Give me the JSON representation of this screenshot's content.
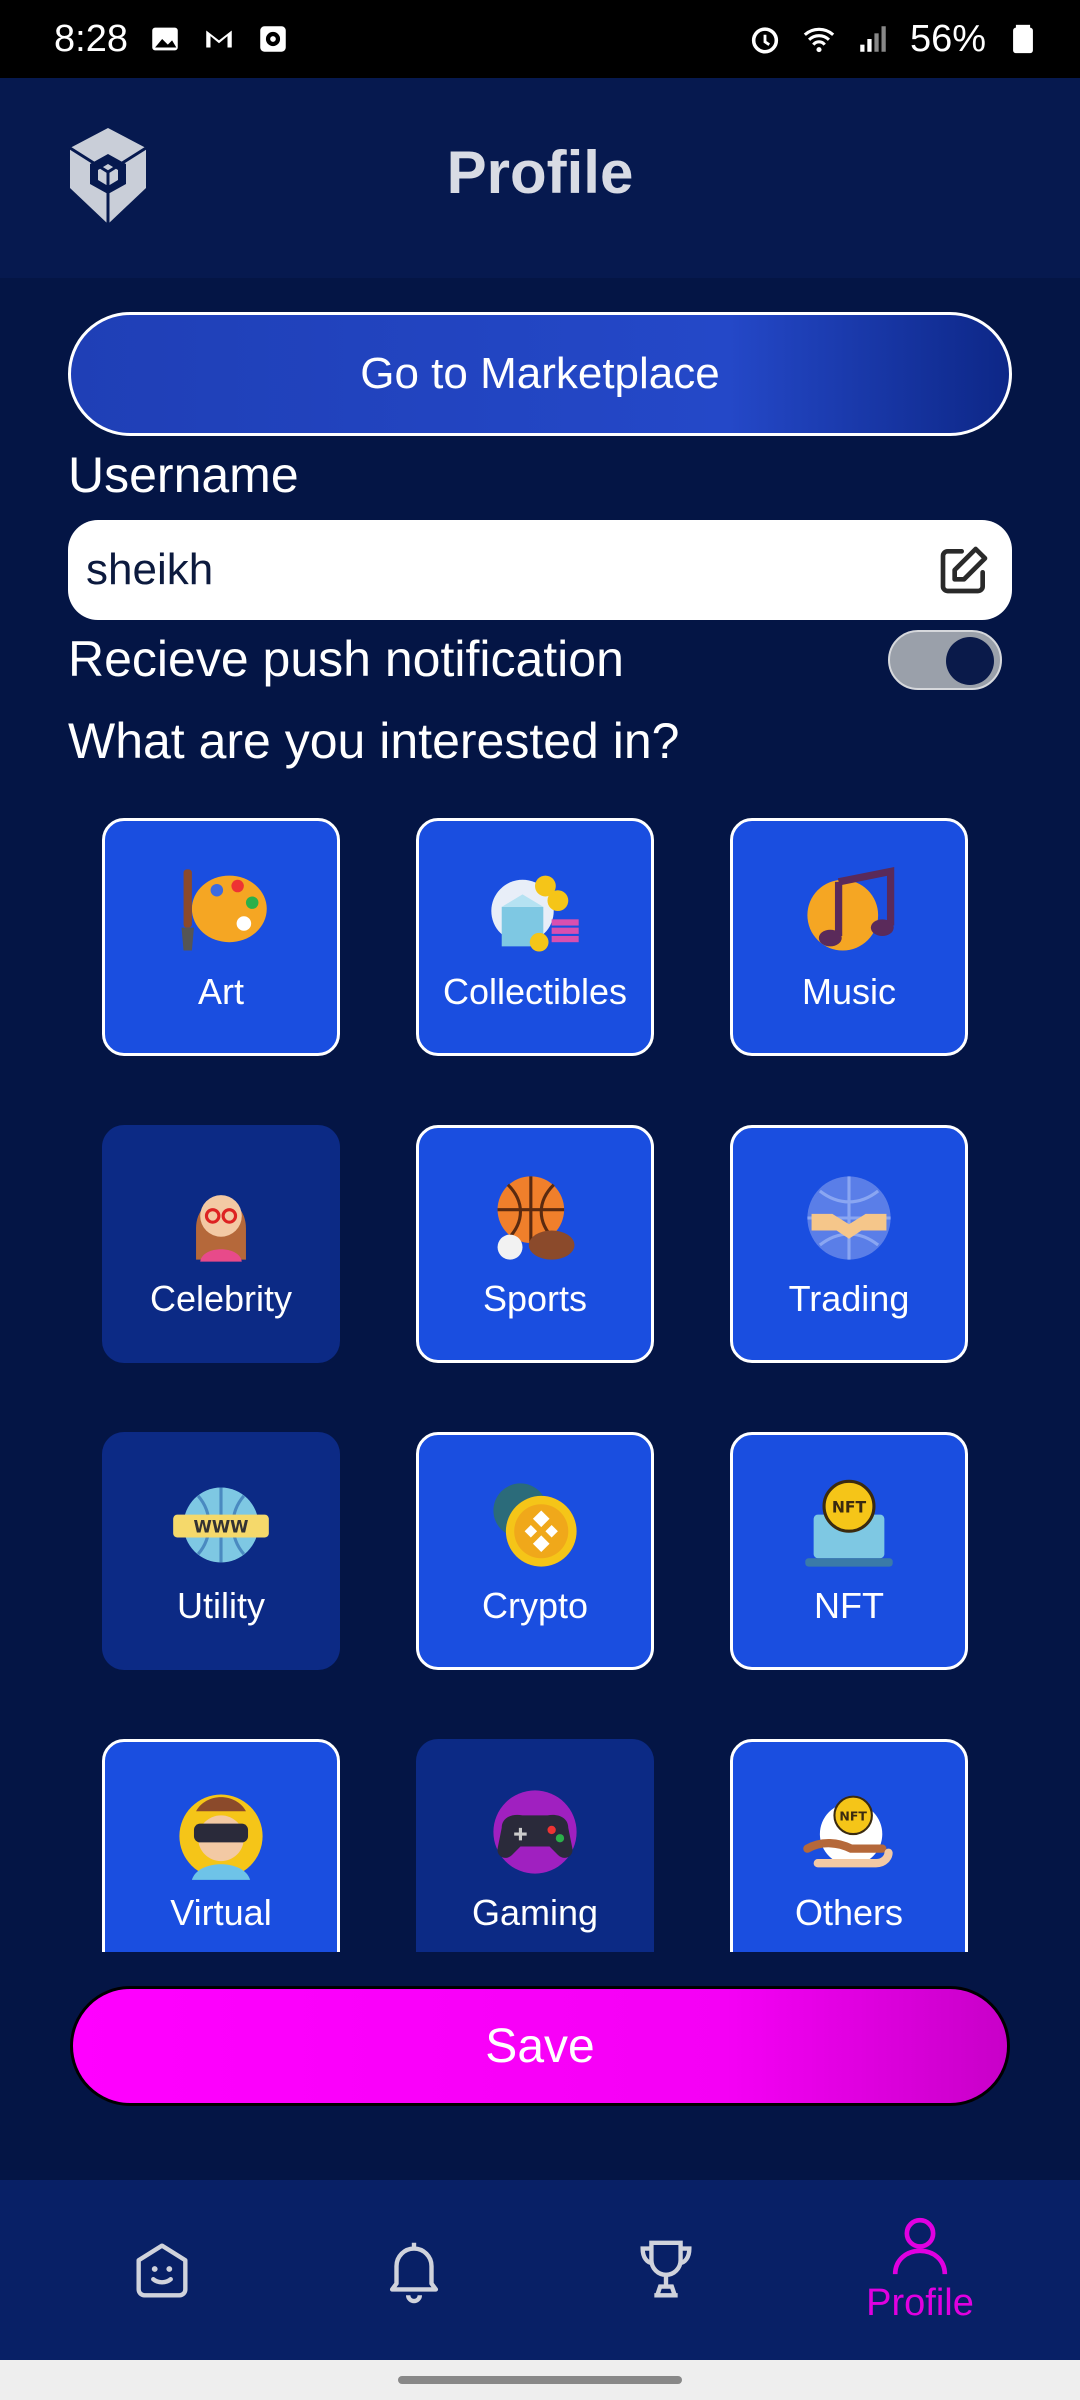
{
  "status_bar": {
    "time": "8:28",
    "battery": "56%",
    "left_icons": [
      "image-icon",
      "gmail-icon",
      "camera-app-icon"
    ],
    "right_icons": [
      "alarm-icon",
      "wifi-icon",
      "signal-icon",
      "battery-icon"
    ]
  },
  "header": {
    "title": "Profile",
    "logo_icon": "shield-logo-icon"
  },
  "profile": {
    "marketplace_button": "Go to Marketplace",
    "username_label": "Username",
    "username_value": "sheikh",
    "push_label": "Recieve push notification",
    "push_enabled": true,
    "interest_label": "What are you interested in?"
  },
  "interests": [
    {
      "label": "Art",
      "icon": "palette-icon",
      "selected": true
    },
    {
      "label": "Collectibles",
      "icon": "coins-box-icon",
      "selected": true
    },
    {
      "label": "Music",
      "icon": "music-note-icon",
      "selected": true
    },
    {
      "label": "Celebrity",
      "icon": "celebrity-icon",
      "selected": false
    },
    {
      "label": "Sports",
      "icon": "sports-balls-icon",
      "selected": true
    },
    {
      "label": "Trading",
      "icon": "handshake-globe-icon",
      "selected": true
    },
    {
      "label": "Utility",
      "icon": "www-globe-icon",
      "selected": false
    },
    {
      "label": "Crypto",
      "icon": "crypto-coin-icon",
      "selected": true
    },
    {
      "label": "NFT",
      "icon": "nft-laptop-icon",
      "selected": true
    },
    {
      "label": "Virtual",
      "icon": "vr-headset-icon",
      "selected": true
    },
    {
      "label": "Gaming",
      "icon": "gamepad-icon",
      "selected": false
    },
    {
      "label": "Others",
      "icon": "nft-hand-icon",
      "selected": true
    }
  ],
  "save_button": "Save",
  "bottom_nav": [
    {
      "name": "home",
      "icon": "smiley-face-icon",
      "label": ""
    },
    {
      "name": "notifications",
      "icon": "bell-icon",
      "label": ""
    },
    {
      "name": "leaderboard",
      "icon": "trophy-icon",
      "label": ""
    },
    {
      "name": "profile",
      "icon": "person-icon",
      "label": "Profile",
      "active": true
    }
  ],
  "colors": {
    "background": "#041545",
    "tile_selected": "#1a4ee0",
    "tile_unselected": "#0c2a85",
    "save": "#ff00ff",
    "nav_active": "#e000e0"
  }
}
